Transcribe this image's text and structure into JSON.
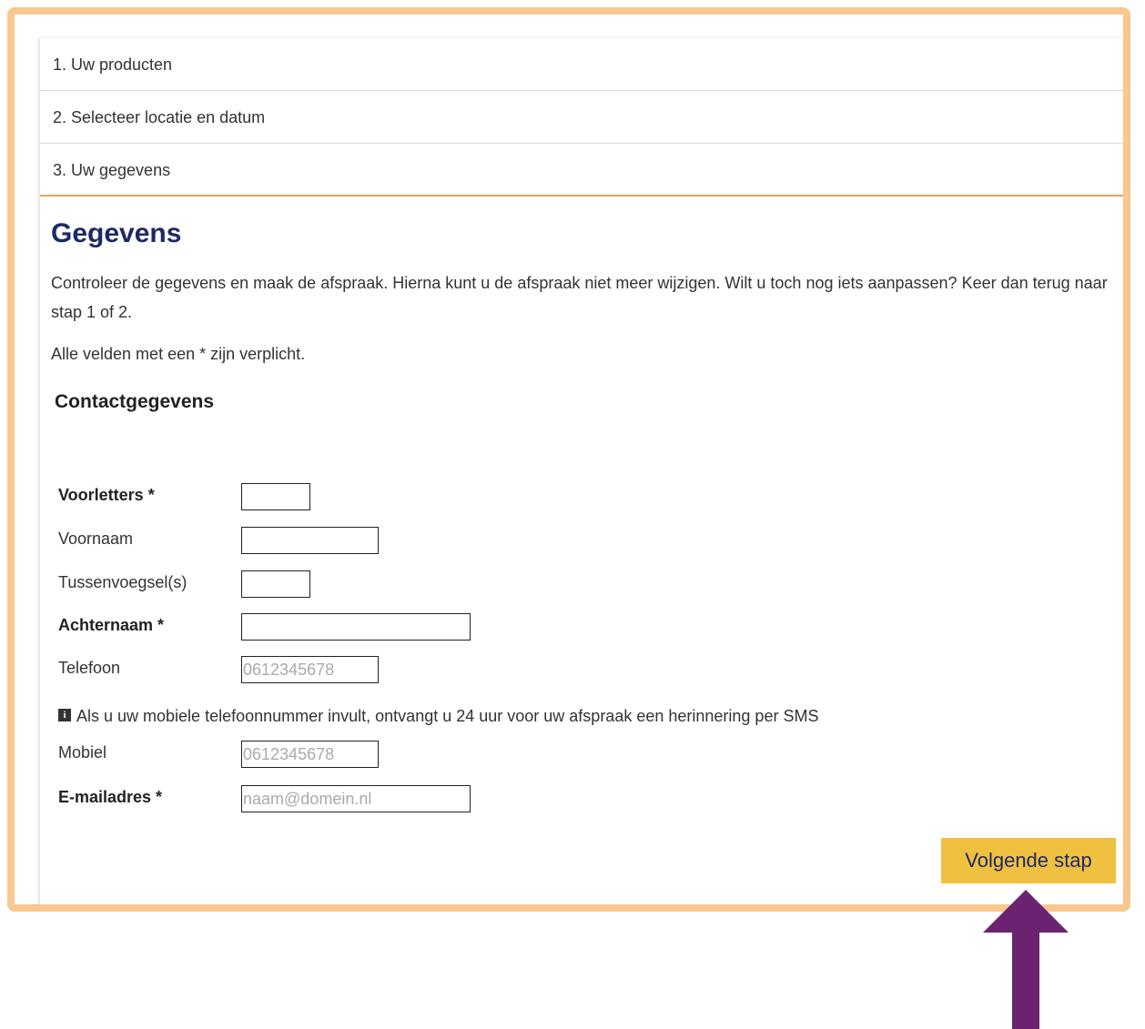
{
  "steps": [
    {
      "label": "1. Uw producten",
      "completed": true
    },
    {
      "label": "2. Selecteer locatie en datum",
      "completed": true
    },
    {
      "label": "3. Uw gegevens",
      "completed": false
    }
  ],
  "page": {
    "title": "Gegevens",
    "intro": "Controleer de gegevens en maak de afspraak. Hierna kunt u de afspraak niet meer wijzigen. Wilt u toch nog iets aanpassen? Keer dan terug naar stap 1 of 2.",
    "required_note": "Alle velden met een * zijn verplicht."
  },
  "contact": {
    "heading": "Contactgegevens",
    "fields": {
      "voorletters": {
        "label": "Voorletters *",
        "value": "",
        "placeholder": ""
      },
      "voornaam": {
        "label": "Voornaam",
        "value": "",
        "placeholder": ""
      },
      "tussenvoegsel": {
        "label": "Tussenvoegsel(s)",
        "value": "",
        "placeholder": ""
      },
      "achternaam": {
        "label": "Achternaam *",
        "value": "",
        "placeholder": ""
      },
      "telefoon": {
        "label": "Telefoon",
        "value": "",
        "placeholder": "0612345678"
      },
      "mobiel": {
        "label": "Mobiel",
        "value": "",
        "placeholder": "0612345678"
      },
      "email": {
        "label": "E-mailadres *",
        "value": "",
        "placeholder": "naam@domein.nl"
      }
    },
    "sms_info": "Als u uw mobiele telefoonnummer invult, ontvangt u 24 uur voor uw afspraak een herinnering per SMS"
  },
  "buttons": {
    "next": "Volgende stap"
  },
  "colors": {
    "frame": "#f7c88f",
    "title": "#1c2a64",
    "active_step_border": "#f0a04b",
    "check": "#3a8a2e",
    "next_button": "#f0c040",
    "annotation_arrow": "#6b2270"
  },
  "icons": {
    "completed": "checkmark-icon",
    "info": "info-icon",
    "annotation": "arrow-up-icon"
  }
}
